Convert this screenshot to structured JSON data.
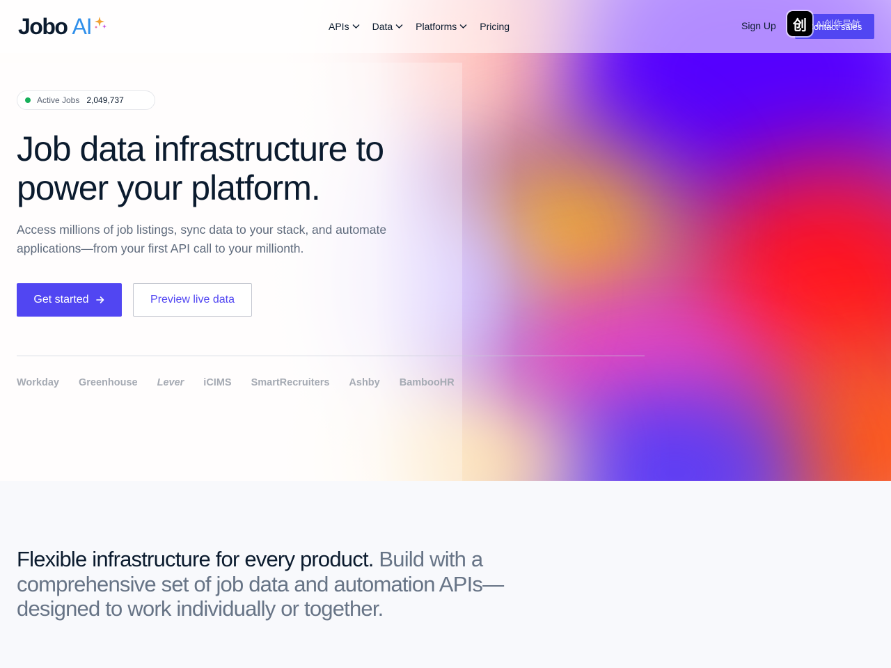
{
  "nav": {
    "logo_main": "Jobo",
    "logo_ai": "AI",
    "items": [
      {
        "label": "APIs",
        "has_dropdown": true
      },
      {
        "label": "Data",
        "has_dropdown": true
      },
      {
        "label": "Platforms",
        "has_dropdown": true
      },
      {
        "label": "Pricing",
        "has_dropdown": false
      }
    ],
    "sign_up": "Sign Up",
    "contact_sales": "Contact sales"
  },
  "overlay": {
    "icon_glyph": "创",
    "text": "AI创作导航"
  },
  "hero": {
    "badge_label": "Active Jobs",
    "badge_count": "2,049,737",
    "headline": "Job data infrastructure to power your platform.",
    "subheadline": "Access millions of job listings, sync data to your stack, and automate applications—from your first API call to your millionth.",
    "primary_cta": "Get started",
    "secondary_cta": "Preview live data",
    "partners": [
      "Workday",
      "Greenhouse",
      "Lever",
      "iCIMS",
      "SmartRecruiters",
      "Ashby",
      "BambooHR"
    ]
  },
  "section": {
    "statement_strong": "Flexible infrastructure for every product.",
    "statement_muted": "Build with a comprehensive set of job data and automation APIs—designed to work individually or together."
  },
  "colors": {
    "accent": "#5146f2",
    "text_dark": "#0b1b2e",
    "text_muted": "#677486",
    "status_green": "#16b05a",
    "logo_ai_blue": "#2f8fea"
  }
}
